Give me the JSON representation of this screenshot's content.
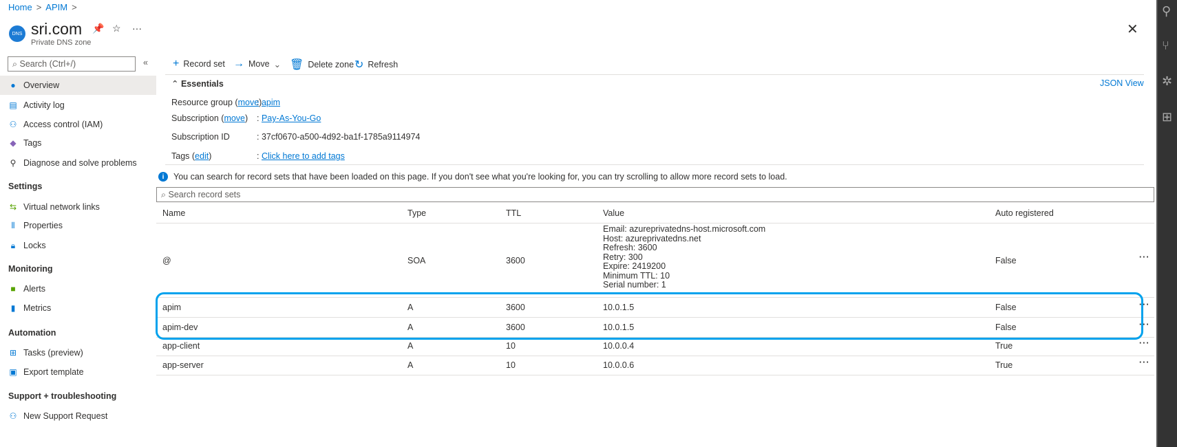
{
  "breadcrumb": [
    "Home",
    "APIM"
  ],
  "header": {
    "logo": "DNS",
    "title": "sri.com",
    "subtitle": "Private DNS zone"
  },
  "sidebar": {
    "search_placeholder": "Search (Ctrl+/)",
    "items": [
      {
        "label": "Overview",
        "icon": "dns-icon"
      },
      {
        "label": "Activity log",
        "icon": "activity-log-icon"
      },
      {
        "label": "Access control (IAM)",
        "icon": "people-icon"
      },
      {
        "label": "Tags",
        "icon": "tag-icon"
      },
      {
        "label": "Diagnose and solve problems",
        "icon": "wrench-icon"
      }
    ],
    "sections": [
      {
        "title": "Settings",
        "items": [
          {
            "label": "Virtual network links"
          },
          {
            "label": "Properties"
          },
          {
            "label": "Locks"
          }
        ]
      },
      {
        "title": "Monitoring",
        "items": [
          {
            "label": "Alerts"
          },
          {
            "label": "Metrics"
          }
        ]
      },
      {
        "title": "Automation",
        "items": [
          {
            "label": "Tasks (preview)"
          },
          {
            "label": "Export template"
          }
        ]
      },
      {
        "title": "Support + troubleshooting",
        "items": [
          {
            "label": "New Support Request"
          }
        ]
      }
    ]
  },
  "toolbar": {
    "record_set": "Record set",
    "move": "Move",
    "delete_zone": "Delete zone",
    "refresh": "Refresh"
  },
  "essentials": {
    "title": "Essentials",
    "json_view": "JSON View",
    "resource_group_label": "Resource group",
    "resource_group": "apim",
    "subscription_label": "Subscription",
    "subscription": "Pay-As-You-Go",
    "subscription_id_label": "Subscription ID",
    "subscription_id": "37cf0670-a500-4d92-ba1f-1785a9114974",
    "tags_label": "Tags",
    "tags": "Click here to add tags",
    "move": "move",
    "edit": "edit"
  },
  "info": "You can search for record sets that have been loaded on this page. If you don't see what you're looking for, you can try scrolling to allow more record sets to load.",
  "records": {
    "search_placeholder": "Search record sets",
    "columns": [
      "Name",
      "Type",
      "TTL",
      "Value",
      "Auto registered"
    ],
    "rows": [
      {
        "name": "@",
        "type": "SOA",
        "ttl": "3600",
        "value": [
          "Email: azureprivatedns-host.microsoft.com",
          "Host: azureprivatedns.net",
          "Refresh: 3600",
          "Retry: 300",
          "Expire: 2419200",
          "Minimum TTL: 10",
          "Serial number: 1"
        ],
        "auto": "False"
      },
      {
        "name": "apim",
        "type": "A",
        "ttl": "3600",
        "value": [
          "10.0.1.5"
        ],
        "auto": "False"
      },
      {
        "name": "apim-dev",
        "type": "A",
        "ttl": "3600",
        "value": [
          "10.0.1.5"
        ],
        "auto": "False"
      },
      {
        "name": "app-client",
        "type": "A",
        "ttl": "10",
        "value": [
          "10.0.0.4"
        ],
        "auto": "True"
      },
      {
        "name": "app-server",
        "type": "A",
        "ttl": "10",
        "value": [
          "10.0.0.6"
        ],
        "auto": "True"
      }
    ]
  },
  "colors": {
    "accent": "#0078d4",
    "highlight": "#00a2ed"
  }
}
